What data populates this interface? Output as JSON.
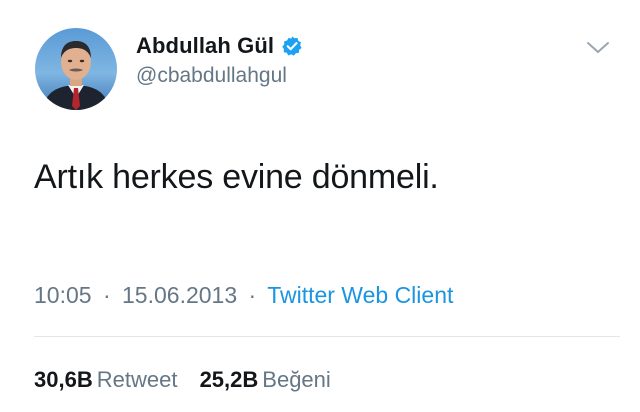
{
  "author": {
    "display_name": "Abdullah Gül",
    "handle": "@cbabdullahgul",
    "verified": true
  },
  "tweet": {
    "text": "Artık herkes evine dönmeli.",
    "time": "10:05",
    "date": "15.06.2013",
    "separator": "·",
    "source": "Twitter Web Client"
  },
  "stats": {
    "retweets_count": "30,6B",
    "retweets_label": "Retweet",
    "likes_count": "25,2B",
    "likes_label": "Beğeni"
  },
  "icons": {
    "verified": "verified-badge-icon",
    "menu": "chevron-down-icon"
  },
  "colors": {
    "name": "#14171a",
    "secondary": "#657786",
    "link": "#1b95e0",
    "verified": "#1da1f2",
    "divider": "#e1e8ed"
  }
}
